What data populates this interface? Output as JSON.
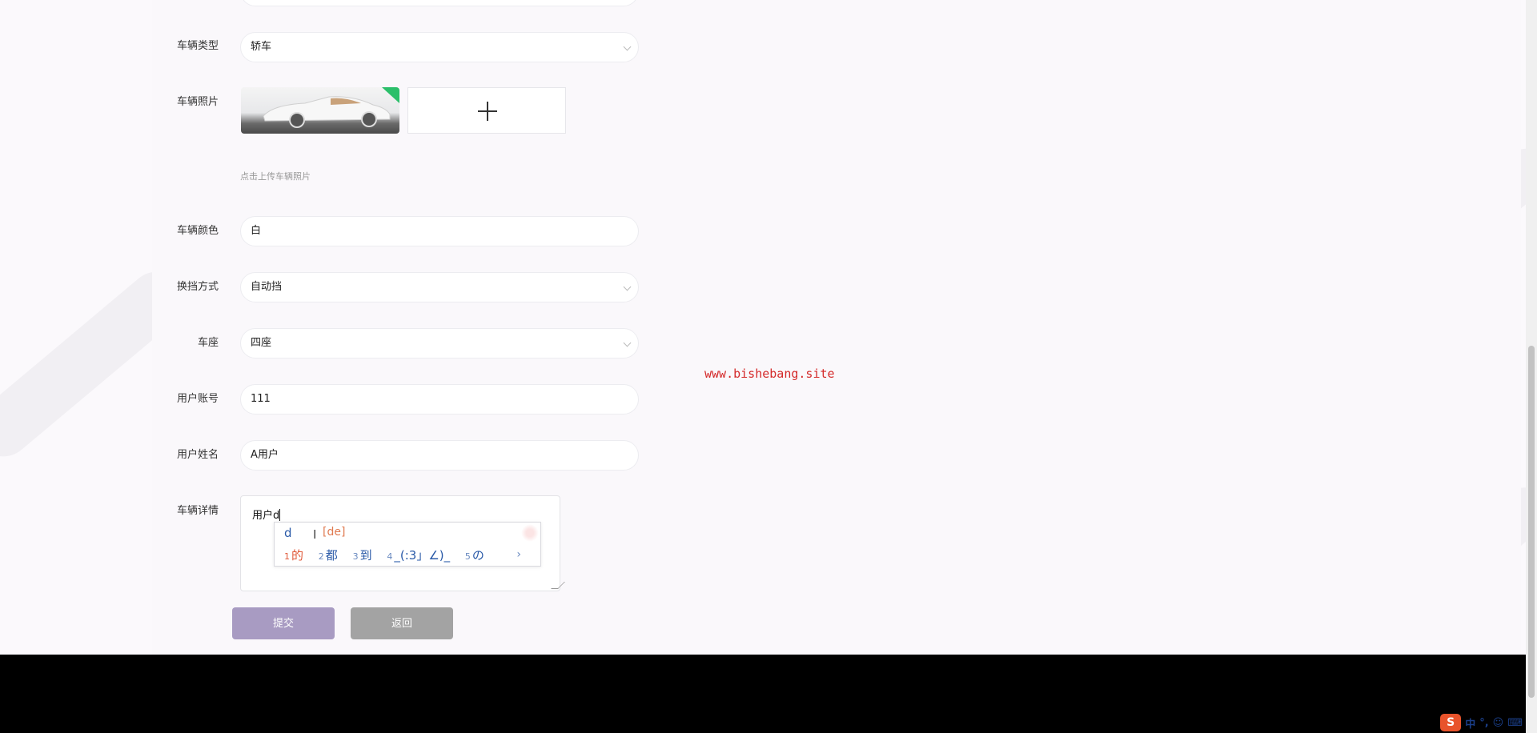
{
  "form": {
    "vehicle_type": {
      "label": "车辆类型",
      "value": "轿车"
    },
    "vehicle_photo": {
      "label": "车辆照片",
      "hint": "点击上传车辆照片"
    },
    "vehicle_color": {
      "label": "车辆颜色",
      "value": "白"
    },
    "transmission": {
      "label": "换挡方式",
      "value": "自动挡"
    },
    "seats": {
      "label": "车座",
      "value": "四座"
    },
    "user_account": {
      "label": "用户账号",
      "value": "111"
    },
    "user_name": {
      "label": "用户姓名",
      "value": "A用户"
    },
    "vehicle_details": {
      "label": "车辆详情",
      "value": "用户d"
    }
  },
  "buttons": {
    "submit": "提交",
    "back": "返回"
  },
  "ime": {
    "input": "d",
    "pinyin": "[de]",
    "candidates": [
      {
        "num": "1",
        "text": "的"
      },
      {
        "num": "2",
        "text": "都"
      },
      {
        "num": "3",
        "text": "到"
      },
      {
        "num": "4",
        "text": "_(:3」∠)_"
      },
      {
        "num": "5",
        "text": "の"
      }
    ],
    "next": "›"
  },
  "watermark": "www.bishebang.site",
  "tray": {
    "logo": "S",
    "lang": "中",
    "punct": "°,",
    "emoji": "☺",
    "keyboard": "⌨"
  },
  "colors": {
    "submit": "#a89bc2",
    "back": "#a3a3a3",
    "watermark": "#d42a2a",
    "ime_logo": "#e8532b"
  }
}
